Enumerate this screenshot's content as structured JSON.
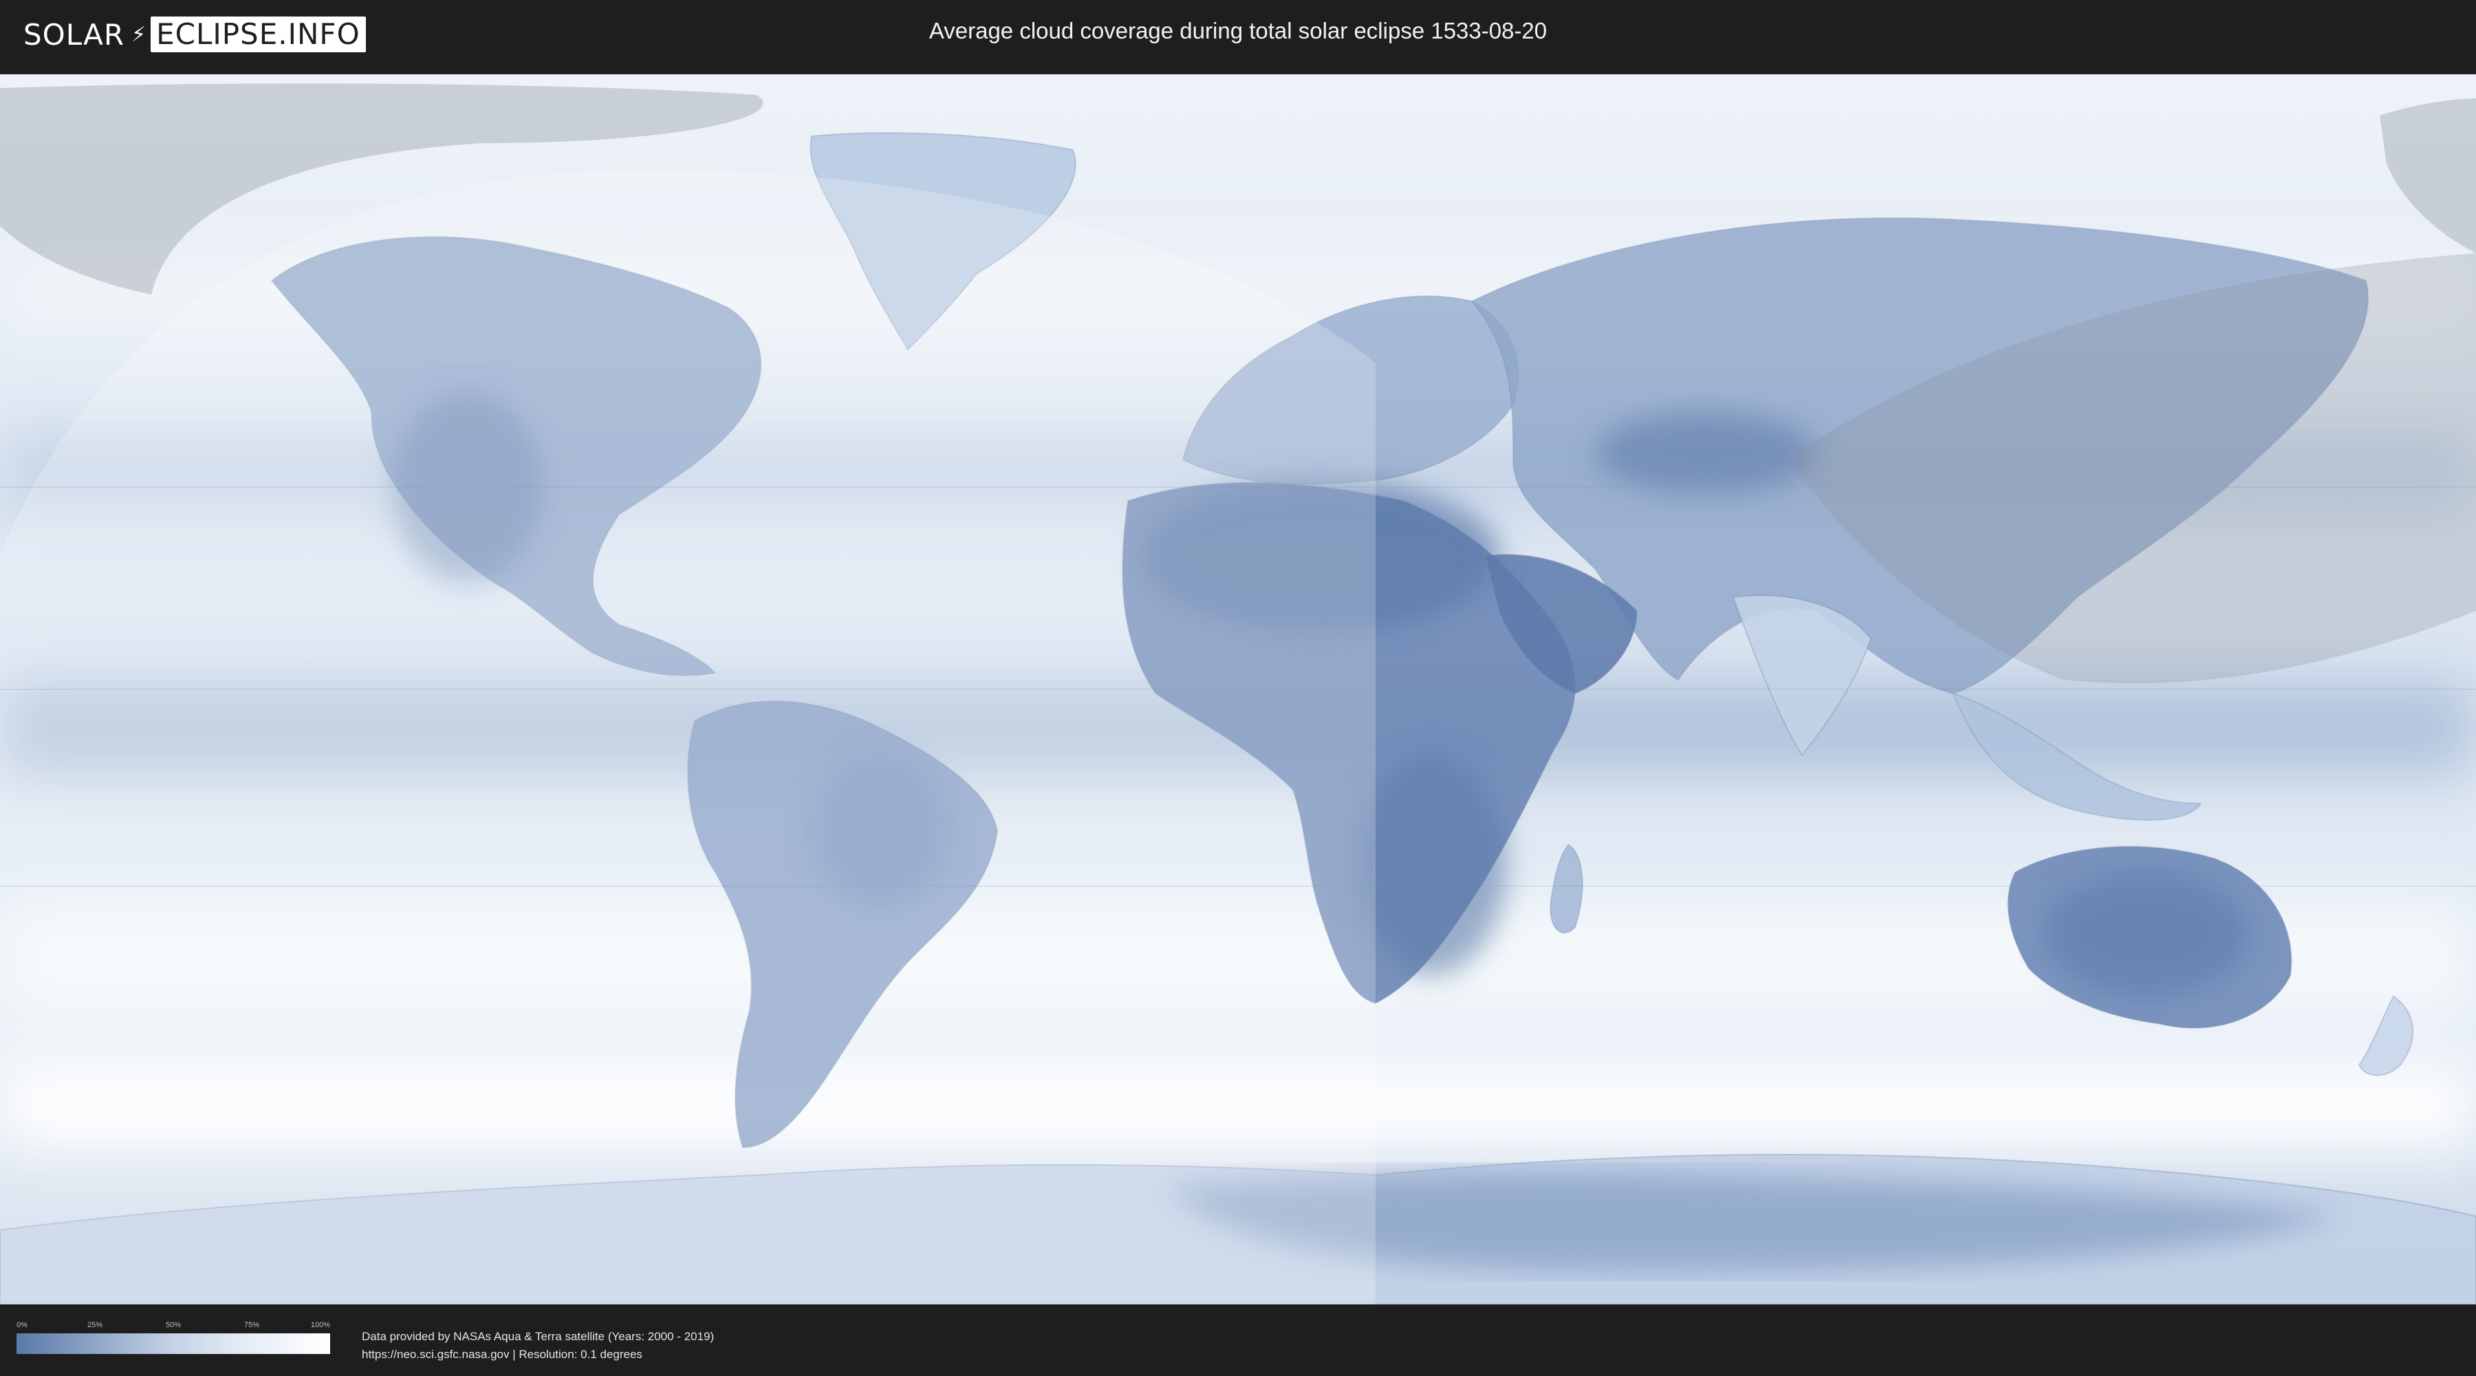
{
  "header": {
    "logo_left": "SOLAR",
    "logo_right": "ECLIPSE.INFO",
    "title": "Average cloud coverage during total solar eclipse 1533-08-20"
  },
  "legend": {
    "ticks": [
      "0%",
      "25%",
      "50%",
      "75%",
      "100%"
    ],
    "colors": {
      "low": "#5a79a8",
      "high": "#ffffff"
    }
  },
  "credits": {
    "line1": "Data provided by NASAs Aqua & Terra satellite (Years: 2000 - 2019)",
    "line2": "https://neo.sci.gsfc.nasa.gov | Resolution: 0.1 degrees"
  }
}
